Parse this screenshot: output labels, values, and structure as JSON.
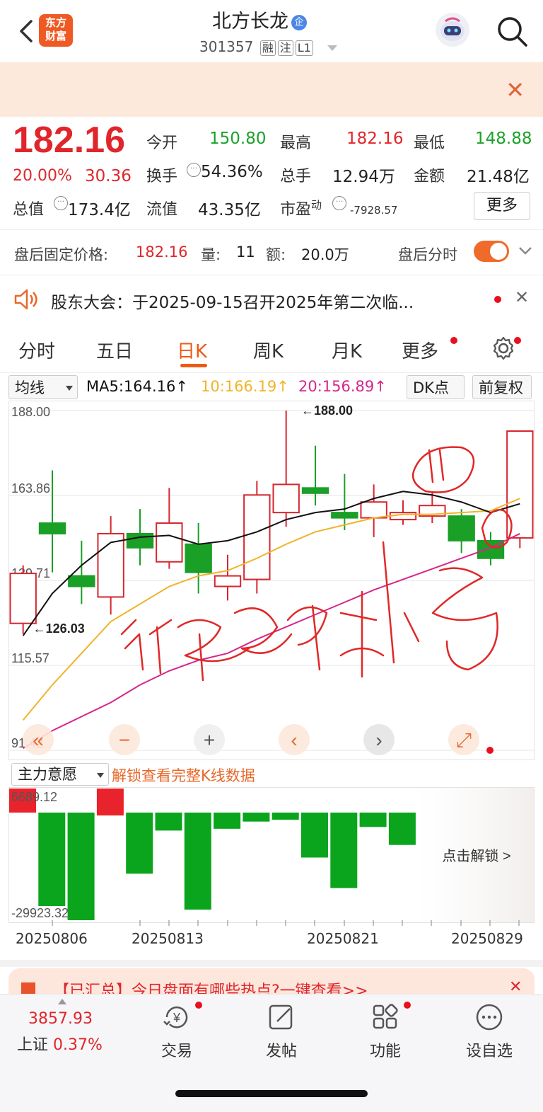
{
  "header": {
    "stock_name": "北方长龙",
    "badge": "企",
    "code": "301357",
    "tags": [
      "融",
      "注",
      "L1"
    ],
    "logo_text_line1": "东方",
    "logo_text_line2": "财富"
  },
  "quote": {
    "price": "182.16",
    "change_pct": "20.00%",
    "change": "30.36",
    "open_label": "今开",
    "open": "150.80",
    "high_label": "最高",
    "high": "182.16",
    "low_label": "最低",
    "low": "148.88",
    "turnover_label": "换手",
    "turnover": "54.36%",
    "volume_label": "总手",
    "volume": "12.94万",
    "amount_label": "金额",
    "amount": "21.48亿",
    "mcap_label": "总值",
    "mcap": "173.4亿",
    "float_label": "流值",
    "float": "43.35亿",
    "pe_label": "市盈",
    "pe_sup": "动",
    "pe": "-7928.57",
    "more_label": "更多"
  },
  "after_hours": {
    "label": "盘后固定价格:",
    "price": "182.16",
    "vol_label": "量:",
    "vol": "11",
    "amt_label": "额:",
    "amt": "20.0万",
    "toggle_label": "盘后分时",
    "toggle_on": true
  },
  "notice": {
    "text": "股东大会：于2025-09-15召开2025年第二次临..."
  },
  "tabs": [
    "分时",
    "五日",
    "日K",
    "周K",
    "月K",
    "更多"
  ],
  "active_tab": "日K",
  "ma_bar": {
    "indicator": "均线",
    "ma5": "MA5:164.16↑",
    "ma10": "10:166.19↑",
    "ma20": "20:156.89↑",
    "dk": "DK点",
    "adjust": "前复权",
    "colors": {
      "ma5": "#111111",
      "ma10": "#f0b429",
      "ma20": "#d6268a",
      "up": "#d7262e",
      "down": "#1a9f27"
    }
  },
  "chart_data": {
    "type": "candlestick",
    "y_ticks": [
      "188.00",
      "163.86",
      "139.71",
      "115.57",
      "91.42"
    ],
    "ylim": [
      91.42,
      188.0
    ],
    "annotations": [
      "←188.00",
      "←126.03"
    ],
    "candles": [
      {
        "o": 127.5,
        "c": 141.7,
        "h": 144.0,
        "l": 124.5
      },
      {
        "o": 156.0,
        "c": 153.0,
        "h": 171.0,
        "l": 142.0
      },
      {
        "o": 141.0,
        "c": 138.0,
        "h": 151.0,
        "l": 133.0
      },
      {
        "o": 135.0,
        "c": 153.0,
        "h": 158.0,
        "l": 130.0
      },
      {
        "o": 153.0,
        "c": 149.0,
        "h": 160.0,
        "l": 144.0
      },
      {
        "o": 145.0,
        "c": 156.0,
        "h": 166.0,
        "l": 143.0
      },
      {
        "o": 150.0,
        "c": 142.0,
        "h": 156.0,
        "l": 136.0
      },
      {
        "o": 138.0,
        "c": 141.0,
        "h": 147.0,
        "l": 134.0
      },
      {
        "o": 140.0,
        "c": 164.0,
        "h": 168.0,
        "l": 136.0
      },
      {
        "o": 159.0,
        "c": 167.0,
        "h": 188.0,
        "l": 155.0
      },
      {
        "o": 166.0,
        "c": 164.5,
        "h": 178.0,
        "l": 161.0
      },
      {
        "o": 159.0,
        "c": 157.5,
        "h": 170.0,
        "l": 154.0
      },
      {
        "o": 157.5,
        "c": 162.0,
        "h": 167.0,
        "l": 152.0
      },
      {
        "o": 157.0,
        "c": 159.0,
        "h": 162.5,
        "l": 155.5
      },
      {
        "o": 158.0,
        "c": 161.0,
        "h": 165.0,
        "l": 156.0
      },
      {
        "o": 158.0,
        "c": 151.0,
        "h": 160.0,
        "l": 147.5
      },
      {
        "o": 151.0,
        "c": 146.0,
        "h": 153.5,
        "l": 144.0
      },
      {
        "o": 151.8,
        "c": 182.16,
        "h": 182.16,
        "l": 148.88
      }
    ],
    "ma5": [
      124.0,
      136.0,
      144.0,
      150.5,
      152.0,
      152.5,
      150.0,
      151.0,
      153.5,
      157.0,
      159.0,
      160.0,
      163.0,
      165.0,
      164.0,
      162.0,
      159.0,
      161.5
    ],
    "ma10": [
      100.0,
      110.0,
      119.0,
      128.0,
      133.0,
      138.0,
      141.0,
      142.5,
      146.0,
      150.0,
      153.5,
      155.5,
      157.5,
      158.5,
      158.5,
      159.0,
      159.5,
      163.0
    ],
    "ma20": [
      92.0,
      97.0,
      101.0,
      105.0,
      110.0,
      114.0,
      117.0,
      119.0,
      123.0,
      126.5,
      130.0,
      133.5,
      137.0,
      140.0,
      143.0,
      146.0,
      149.0,
      153.0
    ]
  },
  "sub_chart": {
    "indicator": "主力意愿",
    "unlock_hint": "解锁查看完整K线数据",
    "top_label": "6689.12",
    "bottom_label": "-29923.32",
    "values": [
      6689,
      -26000,
      -29923,
      7500,
      -17000,
      -5000,
      -27000,
      -4500,
      -2500,
      -2000,
      -12500,
      -21000,
      -4000,
      -9000
    ],
    "unlock_button": "点击解锁 >",
    "up_color": "#e8232b",
    "down_color": "#0aa51c"
  },
  "x_dates": [
    "20250806",
    "20250813",
    "20250821",
    "20250829"
  ],
  "promo": {
    "text": "【已汇总】今日盘面有哪些热点?一键查看>>"
  },
  "bottom_nav": {
    "index_value": "3857.93",
    "index_name": "上证",
    "index_change": "0.37%",
    "items": [
      "交易",
      "发帖",
      "功能",
      "设自选"
    ]
  }
}
